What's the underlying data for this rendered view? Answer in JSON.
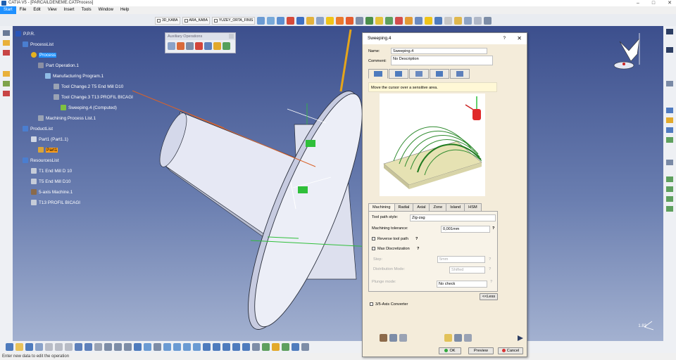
{
  "window": {
    "title": "CATIA V5 - [PARCAİLDENEME.CATProcess]"
  },
  "menubar": {
    "items": [
      "Start",
      "File",
      "Edit",
      "View",
      "Insert",
      "Tools",
      "Window",
      "Help"
    ]
  },
  "toolbar": {
    "combos": [
      "3D_KABA",
      "ARA_KABA",
      "YUZEY_ORTA_FINIS"
    ]
  },
  "aux_toolbar": {
    "title": "Auxiliary Operations"
  },
  "tree": {
    "root": "P.P.R.",
    "process_list": "ProcessList",
    "process": "Process",
    "part_operation": "Part Operation.1",
    "manufacturing_program": "Manufacturing Program.1",
    "tool_change_2": "Tool Change.2  T5 End Mill D10",
    "tool_change_3": "Tool Change.3  T13 PROFIL BICAGI",
    "sweeping": "Sweeping.4 (Computed)",
    "machining_process_list": "Machining Process List.1",
    "product_list": "ProductList",
    "part1": "Part1 (Part1.1)",
    "part1_leaf": "Part1",
    "resources_list": "ResourcesList",
    "r1": "T1 End Mill D 10",
    "r2": "T5 End Mill D10",
    "r3": "5-axis Machine.1",
    "r4": "T13 PROFIL BICAGI"
  },
  "viewport": {
    "zoom_label": "1.82"
  },
  "dialog": {
    "title": "Sweeping.4",
    "help": "?",
    "close": "✕",
    "name_label": "Name:",
    "name_value": "Sweeping.4",
    "comment_label": "Comment:",
    "comment_value": "No Description",
    "hint": "Move the cursor over a sensitive area.",
    "subtabs": [
      "Machining",
      "Radial",
      "Axial",
      "Zone",
      "Island",
      "HSM"
    ],
    "tool_path_style_label": "Tool path style:",
    "tool_path_style_value": "Zig-zag",
    "machining_tolerance_label": "Machining tolerance:",
    "machining_tolerance_value": "0,001mm",
    "reverse_tool_path": "Reverse tool path",
    "max_discretization": "Max Discretization",
    "step_label": "Step:",
    "step_value": "5mm",
    "distribution_mode_label": "Distribution Mode:",
    "distribution_mode_value": "Shifted",
    "plunge_mode_label": "Plunge mode:",
    "plunge_mode_value": "No check",
    "less_button": "<<Less",
    "converter": "3/5-Axis Converter",
    "ok": "OK",
    "preview": "Preview",
    "cancel": "Cancel"
  },
  "statusbar": {
    "text": "Enter new data to edit the operation"
  },
  "colors": {
    "accent": "#1e90ff",
    "viewport_top": "#3c4f8d",
    "viewport_bottom": "#a3b1d0",
    "dialog_bg": "#f4ecda",
    "highlight_orange": "#ff9f1c"
  }
}
